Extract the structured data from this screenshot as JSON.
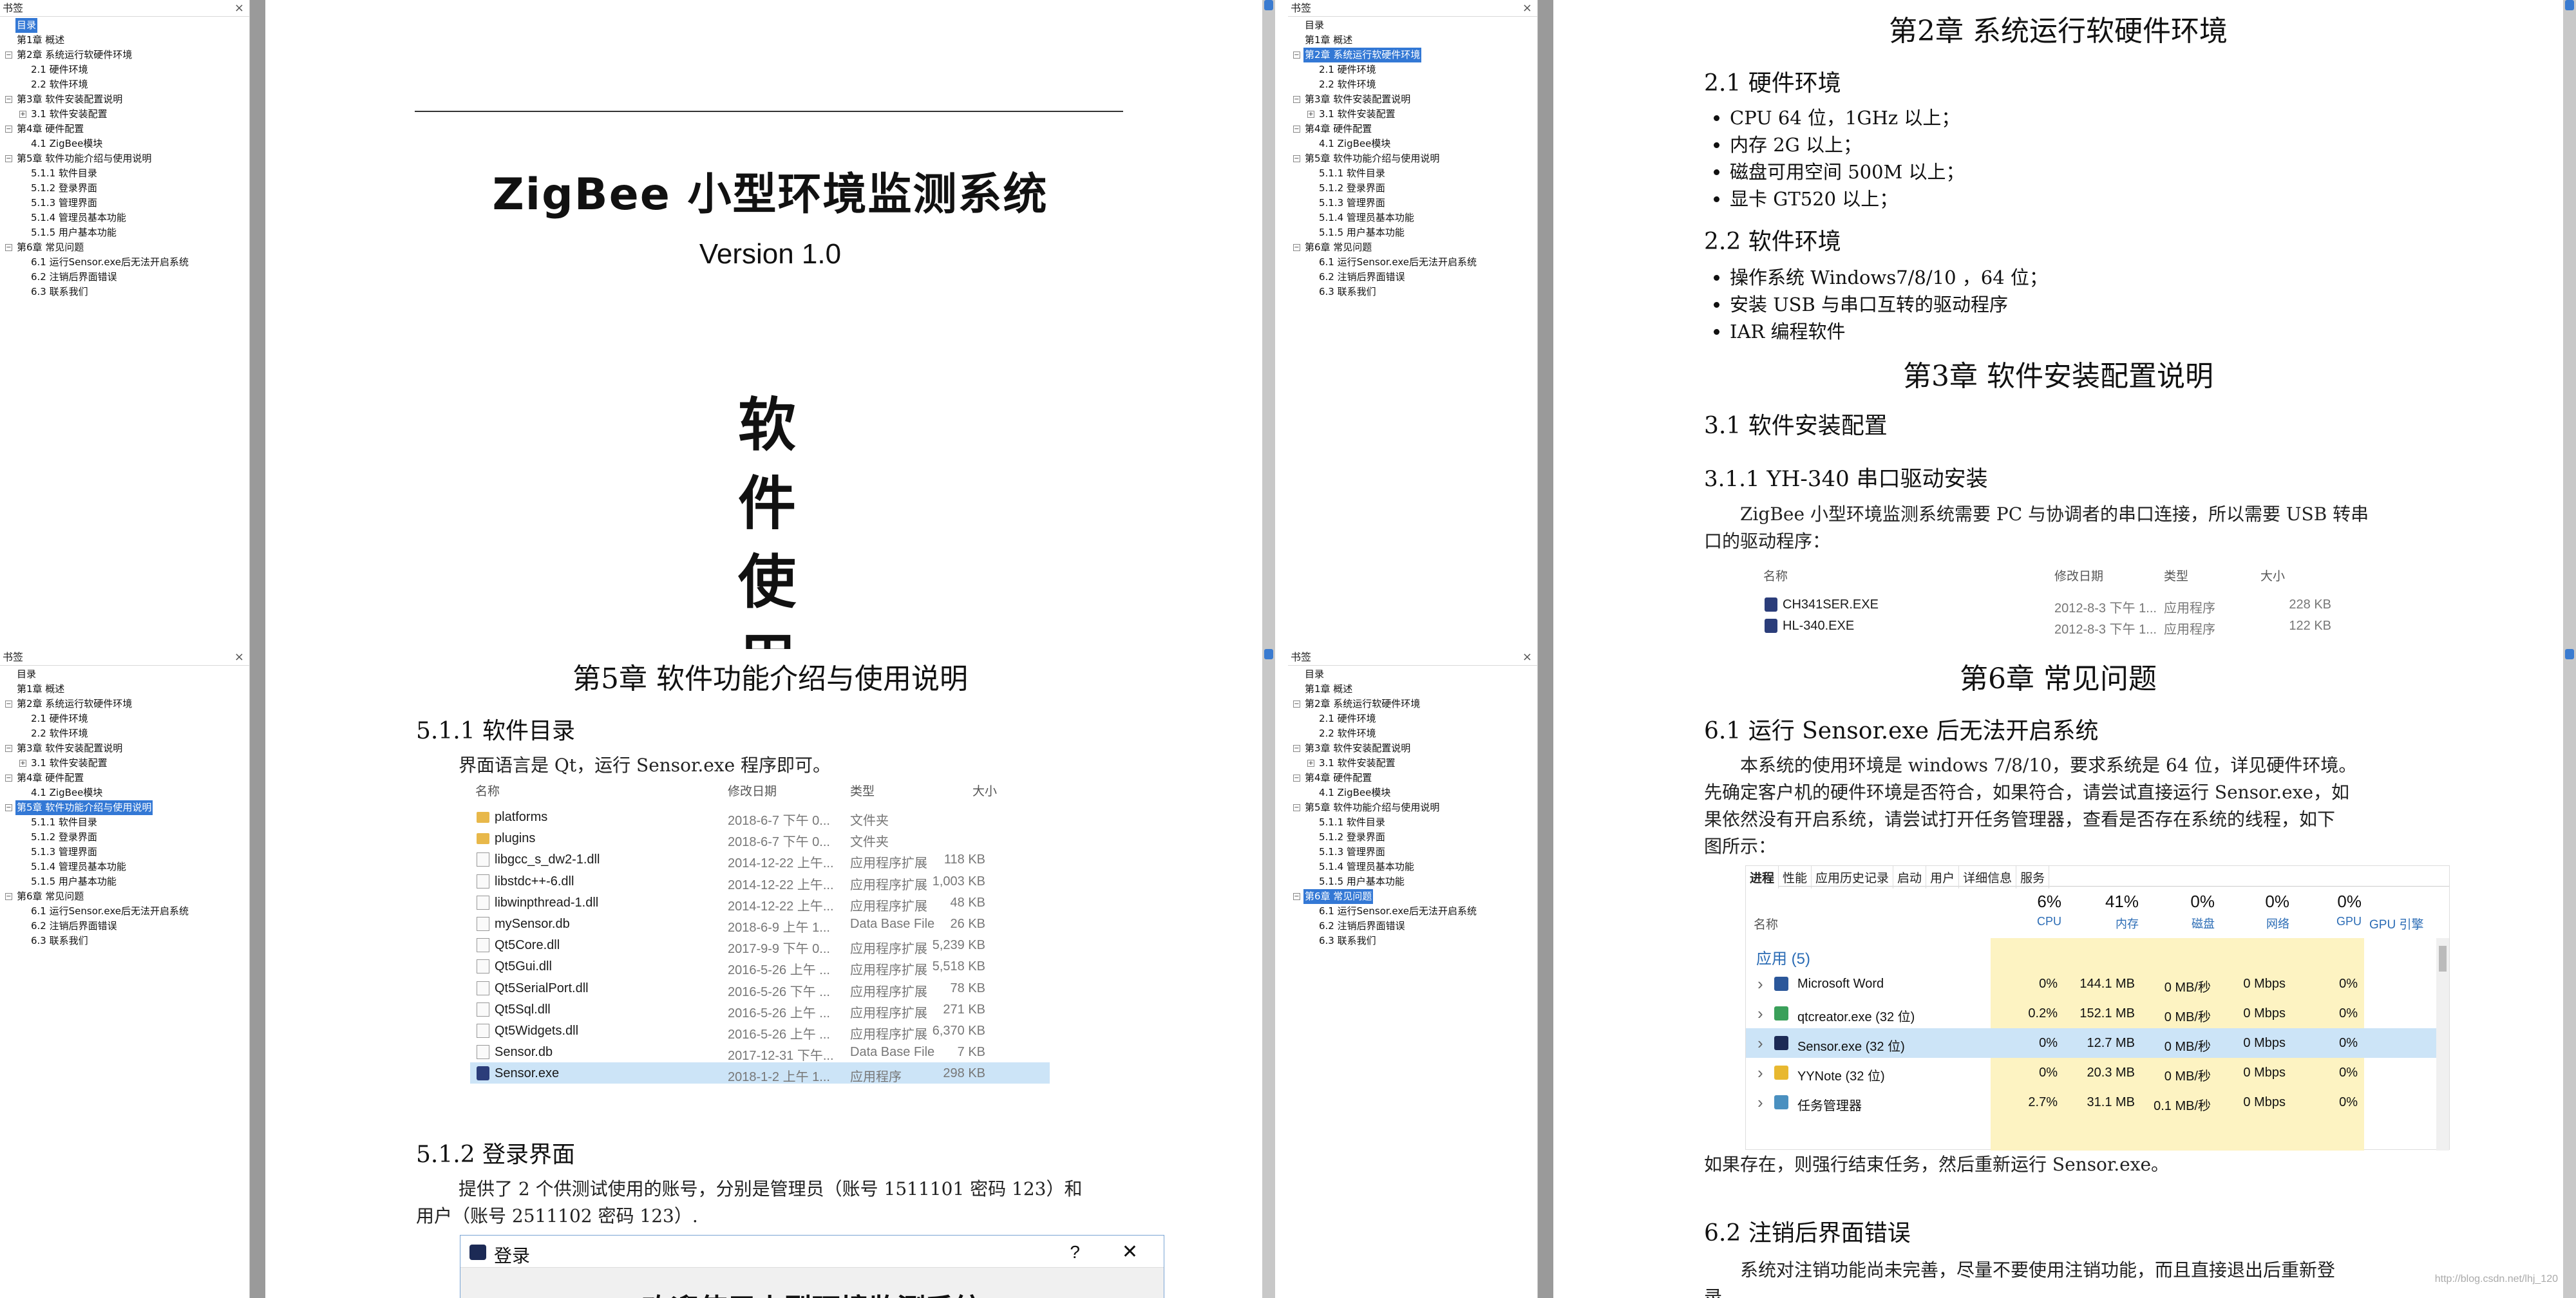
{
  "bookmark_panel": {
    "title": "书签",
    "close": "×",
    "items": [
      {
        "label": "目录",
        "level": 0,
        "toggle": ""
      },
      {
        "label": "第1章 概述",
        "level": 0,
        "toggle": ""
      },
      {
        "label": "第2章 系统运行软硬件环境",
        "level": 0,
        "toggle": "−"
      },
      {
        "label": "2.1 硬件环境",
        "level": 1,
        "toggle": ""
      },
      {
        "label": "2.2 软件环境",
        "level": 1,
        "toggle": ""
      },
      {
        "label": "第3章 软件安装配置说明",
        "level": 0,
        "toggle": "−"
      },
      {
        "label": "3.1 软件安装配置",
        "level": 1,
        "toggle": "+"
      },
      {
        "label": "第4章 硬件配置",
        "level": 0,
        "toggle": "−"
      },
      {
        "label": "4.1 ZigBee模块",
        "level": 1,
        "toggle": ""
      },
      {
        "label": "第5章 软件功能介绍与使用说明",
        "level": 0,
        "toggle": "−"
      },
      {
        "label": "5.1.1 软件目录",
        "level": 1,
        "toggle": ""
      },
      {
        "label": "5.1.2 登录界面",
        "level": 1,
        "toggle": ""
      },
      {
        "label": "5.1.3 管理界面",
        "level": 1,
        "toggle": ""
      },
      {
        "label": "5.1.4 管理员基本功能",
        "level": 1,
        "toggle": ""
      },
      {
        "label": "5.1.5 用户基本功能",
        "level": 1,
        "toggle": ""
      },
      {
        "label": "第6章 常见问题",
        "level": 0,
        "toggle": "−"
      },
      {
        "label": "6.1 运行Sensor.exe后无法开启系统",
        "level": 1,
        "toggle": ""
      },
      {
        "label": "6.2 注销后界面错误",
        "level": 1,
        "toggle": ""
      },
      {
        "label": "6.3 联系我们",
        "level": 1,
        "toggle": ""
      }
    ]
  },
  "q1": {
    "title": "ZigBee 小型环境监测系统",
    "version": "Version 1.0",
    "vertical_chars": [
      "软",
      "件",
      "使",
      "用"
    ]
  },
  "q2": {
    "chapter": "第2章  系统运行软硬件环境",
    "s21": "2.1  硬件环境",
    "hw": [
      "CPU 64 位，1GHz 以上；",
      "内存 2G 以上；",
      "磁盘可用空间 500M 以上；",
      "显卡 GT520 以上；"
    ],
    "s22": "2.2  软件环境",
    "sw": [
      "操作系统  Windows7/8/10 ，64 位；",
      "安装 USB 与串口互转的驱动程序",
      "IAR 编程软件"
    ],
    "chapter3": "第3章  软件安装配置说明",
    "s31": "3.1  软件安装配置",
    "s311": "3.1.1  YH-340 串口驱动安装",
    "para1": "ZigBee 小型环境监测系统需要 PC 与协调者的串口连接，所以需要 USB 转串",
    "para2": "口的驱动程序：",
    "list_head": {
      "name": "名称",
      "date": "修改日期",
      "type": "类型",
      "size": "大小"
    },
    "files": [
      {
        "name": "CH341SER.EXE",
        "date": "2012-8-3 下午 1...",
        "type": "应用程序",
        "size": "228 KB"
      },
      {
        "name": "HL-340.EXE",
        "date": "2012-8-3 下午 1...",
        "type": "应用程序",
        "size": "122 KB"
      }
    ]
  },
  "q3": {
    "chapter": "第5章  软件功能介绍与使用说明",
    "s511": "5.1.1   软件目录",
    "intro": "界面语言是 Qt，运行 Sensor.exe 程序即可。",
    "list_head": {
      "name": "名称",
      "date": "修改日期",
      "type": "类型",
      "size": "大小"
    },
    "files": [
      {
        "name": "platforms",
        "date": "2018-6-7 下午 0...",
        "type": "文件夹",
        "size": "",
        "icon": "folder"
      },
      {
        "name": "plugins",
        "date": "2018-6-7 下午 0...",
        "type": "文件夹",
        "size": "",
        "icon": "folder"
      },
      {
        "name": "libgcc_s_dw2-1.dll",
        "date": "2014-12-22 上午...",
        "type": "应用程序扩展",
        "size": "118 KB",
        "icon": "file"
      },
      {
        "name": "libstdc++-6.dll",
        "date": "2014-12-22 上午...",
        "type": "应用程序扩展",
        "size": "1,003 KB",
        "icon": "file"
      },
      {
        "name": "libwinpthread-1.dll",
        "date": "2014-12-22 上午...",
        "type": "应用程序扩展",
        "size": "48 KB",
        "icon": "file"
      },
      {
        "name": "mySensor.db",
        "date": "2018-6-9 上午 1...",
        "type": "Data Base File",
        "size": "26 KB",
        "icon": "file"
      },
      {
        "name": "Qt5Core.dll",
        "date": "2017-9-9 下午 0...",
        "type": "应用程序扩展",
        "size": "5,239 KB",
        "icon": "file"
      },
      {
        "name": "Qt5Gui.dll",
        "date": "2016-5-26 上午 ...",
        "type": "应用程序扩展",
        "size": "5,518 KB",
        "icon": "file"
      },
      {
        "name": "Qt5SerialPort.dll",
        "date": "2016-5-26 下午 ...",
        "type": "应用程序扩展",
        "size": "78 KB",
        "icon": "file"
      },
      {
        "name": "Qt5Sql.dll",
        "date": "2016-5-26 上午 ...",
        "type": "应用程序扩展",
        "size": "271 KB",
        "icon": "file"
      },
      {
        "name": "Qt5Widgets.dll",
        "date": "2016-5-26 上午 ...",
        "type": "应用程序扩展",
        "size": "6,370 KB",
        "icon": "file"
      },
      {
        "name": "Sensor.db",
        "date": "2017-12-31 下午...",
        "type": "Data Base File",
        "size": "7 KB",
        "icon": "file"
      },
      {
        "name": "Sensor.exe",
        "date": "2018-1-2 上午 1...",
        "type": "应用程序",
        "size": "298 KB",
        "icon": "exe"
      }
    ],
    "s512": "5.1.2   登录界面",
    "login1": "提供了 2 个供测试使用的账号，分别是管理员（账号 1511101 密码 123）和",
    "login2": "用户（账号 2511102 密码 123）.",
    "dialog_title": "登录",
    "dialog_help": "?",
    "dialog_close": "✕",
    "dialog_text": "欢迎使用小型环境监测系统"
  },
  "q4": {
    "chapter": "第6章  常见问题",
    "s61": "6.1  运行 Sensor.exe 后无法开启系统",
    "p1": "本系统的使用环境是 windows 7/8/10，要求系统是 64 位，详见硬件环境。",
    "p2": "先确定客户机的硬件环境是否符合，如果符合，请尝试直接运行 Sensor.exe，如",
    "p3": "果依然没有开启系统，请尝试打开任务管理器，查看是否存在系统的线程，如下",
    "p4": "图所示：",
    "tabs": [
      "进程",
      "性能",
      "应用历史记录",
      "启动",
      "用户",
      "详细信息",
      "服务"
    ],
    "col_name": "名称",
    "cols": [
      {
        "pct": "6%",
        "label": "CPU"
      },
      {
        "pct": "41%",
        "label": "内存"
      },
      {
        "pct": "0%",
        "label": "磁盘"
      },
      {
        "pct": "0%",
        "label": "网络"
      },
      {
        "pct": "0%",
        "label": "GPU"
      }
    ],
    "gpu_engine": "GPU 引擎",
    "group": "应用 (5)",
    "rows": [
      {
        "name": "Microsoft Word",
        "cpu": "0%",
        "mem": "144.1 MB",
        "disk": "0 MB/秒",
        "net": "0 Mbps",
        "gpu": "0%"
      },
      {
        "name": "qtcreator.exe (32 位)",
        "cpu": "0.2%",
        "mem": "152.1 MB",
        "disk": "0 MB/秒",
        "net": "0 Mbps",
        "gpu": "0%"
      },
      {
        "name": "Sensor.exe (32 位)",
        "cpu": "0%",
        "mem": "12.7 MB",
        "disk": "0 MB/秒",
        "net": "0 Mbps",
        "gpu": "0%"
      },
      {
        "name": "YYNote (32 位)",
        "cpu": "0%",
        "mem": "20.3 MB",
        "disk": "0 MB/秒",
        "net": "0 Mbps",
        "gpu": "0%"
      },
      {
        "name": "任务管理器",
        "cpu": "2.7%",
        "mem": "31.1 MB",
        "disk": "0.1 MB/秒",
        "net": "0 Mbps",
        "gpu": "0%"
      }
    ],
    "after": "如果存在，则强行结束任务，然后重新运行 Sensor.exe。",
    "s62": "6.2  注销后界面错误",
    "p5": "系统对注销功能尚未完善，尽量不要使用注销功能，而且直接退出后重新登",
    "p6": "录。",
    "watermark": "http://blog.csdn.net/lhj_120"
  }
}
